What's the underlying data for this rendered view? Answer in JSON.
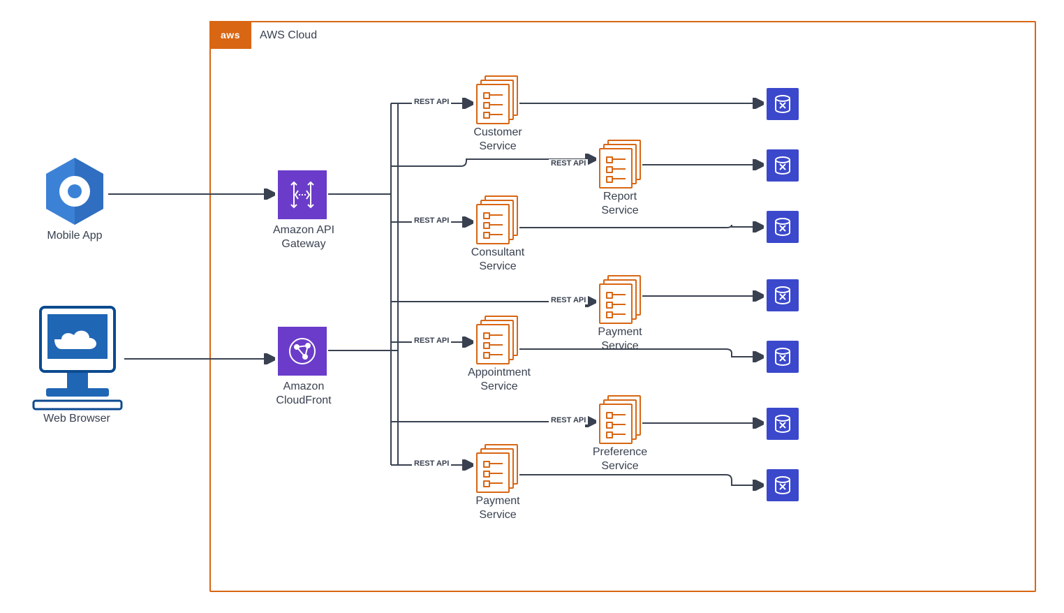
{
  "cloud": {
    "tag": "aws",
    "title": "AWS Cloud"
  },
  "clients": {
    "mobile": {
      "label": "Mobile App"
    },
    "web": {
      "label": "Web Browser"
    }
  },
  "gateway": {
    "api": {
      "label": "Amazon API\nGateway"
    },
    "cf": {
      "label": "Amazon\nCloudFront"
    }
  },
  "services_left": [
    {
      "label": "Customer\nService"
    },
    {
      "label": "Consultant\nService"
    },
    {
      "label": "Appointment\nService"
    },
    {
      "label": "Payment\nService"
    }
  ],
  "services_right": [
    {
      "label": "Report\nService"
    },
    {
      "label": "Payment\nService"
    },
    {
      "label": "Preference\nService"
    }
  ],
  "edge_label": "REST API"
}
